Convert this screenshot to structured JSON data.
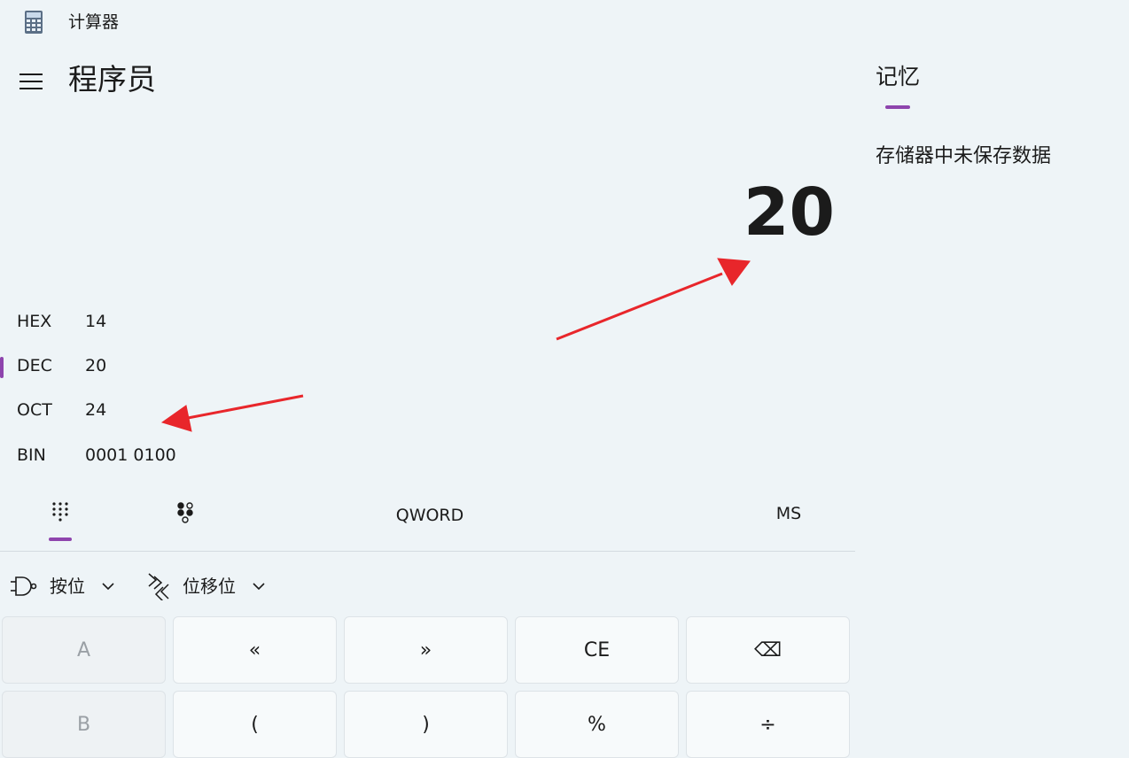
{
  "window": {
    "title": "计算器"
  },
  "header": {
    "mode_title": "程序员"
  },
  "display": {
    "result": "20"
  },
  "radix": [
    {
      "label": "HEX",
      "value": "14"
    },
    {
      "label": "DEC",
      "value": "20",
      "selected": true
    },
    {
      "label": "OCT",
      "value": "24"
    },
    {
      "label": "BIN",
      "value": "0001 0100"
    }
  ],
  "toolbar": {
    "word_size": "QWORD",
    "memory_store": "MS"
  },
  "dropdowns": {
    "bitwise": "按位",
    "bitshift": "位移位"
  },
  "keys": {
    "row1": [
      "A",
      "«",
      "»",
      "CE",
      "⌫"
    ],
    "row2": [
      "B",
      "(",
      ")",
      "%",
      "÷"
    ]
  },
  "memory": {
    "tab_label": "记忆",
    "empty_message": "存储器中未保存数据"
  },
  "colors": {
    "accent": "#8e44ad",
    "background": "#eef4f7",
    "annotation_arrow": "#e8262b"
  }
}
